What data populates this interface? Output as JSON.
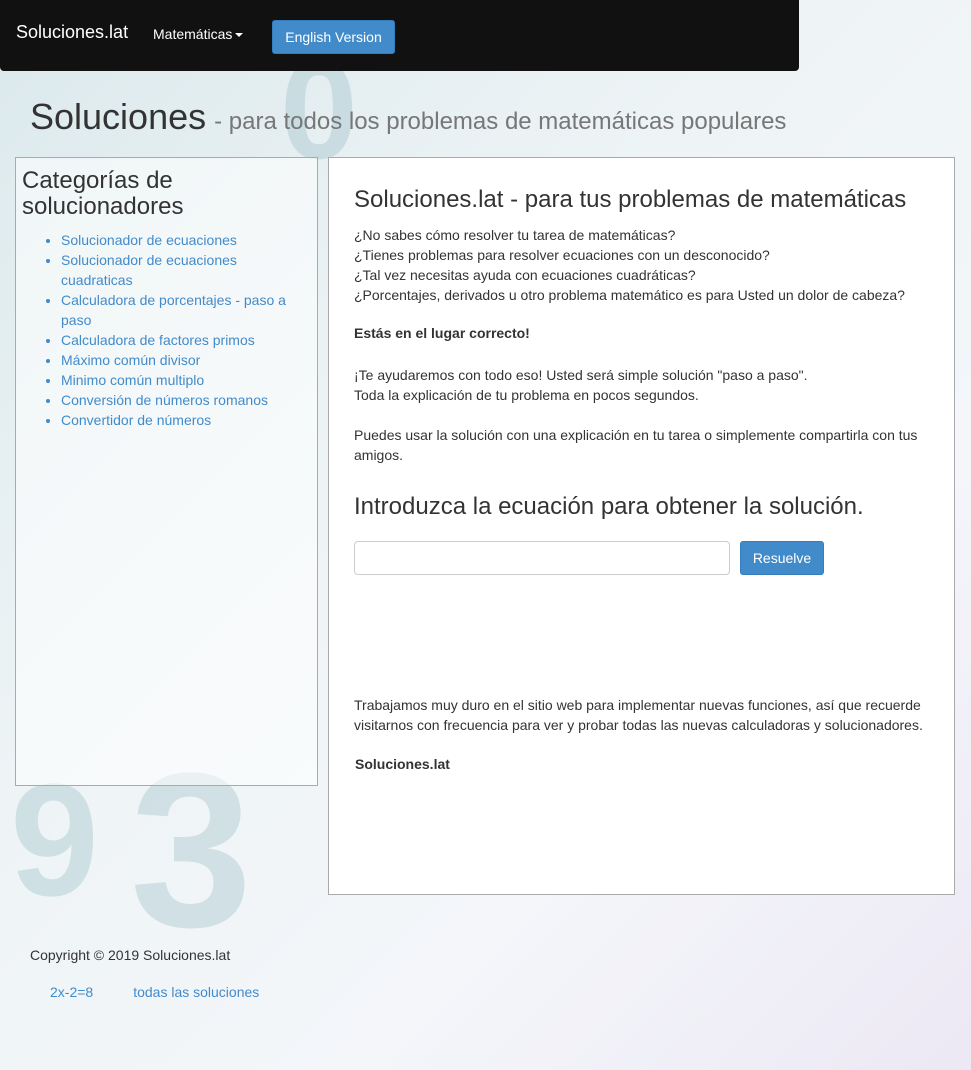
{
  "navbar": {
    "brand": "Soluciones.lat",
    "dropdown_label": "Matemáticas",
    "english_button": "English Version"
  },
  "header": {
    "title": "Soluciones",
    "subtitle": "- para todos los problemas de matemáticas populares"
  },
  "sidebar": {
    "heading": "Categorías de solucionadores",
    "items": [
      {
        "label": "Solucionador de ecuaciones"
      },
      {
        "label": "Solucionador de ecuaciones cuadraticas"
      },
      {
        "label": "Calculadora de porcentajes - paso a paso"
      },
      {
        "label": "Calculadora de factores primos"
      },
      {
        "label": "Máximo común divisor"
      },
      {
        "label": "Minimo común multiplo"
      },
      {
        "label": "Conversión de números romanos"
      },
      {
        "label": "Convertidor de números"
      }
    ]
  },
  "main": {
    "title": "Soluciones.lat - para tus problemas de matemáticas",
    "intro_lines": [
      "¿No sabes cómo resolver tu tarea de matemáticas?",
      "¿Tienes problemas para resolver ecuaciones con un desconocido?",
      "¿Tal vez necesitas ayuda con ecuaciones cuadráticas?",
      "¿Porcentajes, derivados u otro problema matemático es para Usted un dolor de cabeza?"
    ],
    "strong_line": "Estás en el lugar correcto!",
    "para2_lines": [
      "¡Te ayudaremos con todo eso! Usted será simple solución \"paso a paso\".",
      "Toda la explicación de tu problema en pocos segundos."
    ],
    "para3": "Puedes usar la solución con una explicación en tu tarea o simplemente compartirla con tus amigos.",
    "equation_heading": "Introduzca la ecuación para obtener la solución.",
    "equation_value": "",
    "solve_button": "Resuelve",
    "para4": "Trabajamos muy duro en el sitio web para implementar nuevas funciones, así que recuerde visitarnos con frecuencia para ver y probar todas las nuevas calculadoras y solucionadores.",
    "signature": "Soluciones.lat"
  },
  "footer": {
    "copyright": "Copyright © 2019 Soluciones.lat",
    "links": [
      {
        "label": "2x-2=8"
      },
      {
        "label": "todas las soluciones"
      }
    ]
  },
  "colors": {
    "accent": "#428bca",
    "navbar": "#111111"
  }
}
